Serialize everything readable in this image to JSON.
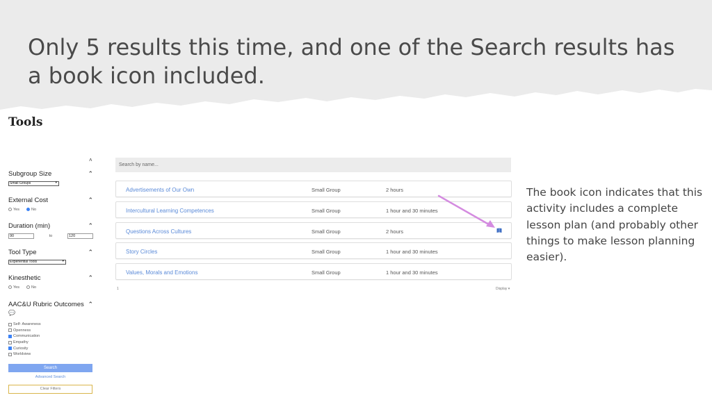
{
  "slide": {
    "title": "Only 5 results this time, and one of the Search results has a book icon included.",
    "note": "The book icon indicates that this activity includes a complete lesson plan (and probably other things to make lesson planning easier)."
  },
  "tools": {
    "heading": "Tools",
    "collapse_caret": "˄",
    "filters": {
      "subgroup_size": {
        "label": "Subgroup Size",
        "selected": "Small Groups"
      },
      "external_cost": {
        "label": "External Cost",
        "options": [
          "Yes",
          "No"
        ],
        "selected": "No"
      },
      "duration": {
        "label": "Duration (min)",
        "min": "90",
        "to": "to",
        "max": "120"
      },
      "tool_type": {
        "label": "Tool Type",
        "selected": "Experiential Tools"
      },
      "kinesthetic": {
        "label": "Kinesthetic",
        "options": [
          "Yes",
          "No"
        ],
        "selected": ""
      },
      "rubric": {
        "label": "AAC&U Rubric Outcomes",
        "items": [
          {
            "label": "Self- Awareness",
            "checked": false
          },
          {
            "label": "Openness",
            "checked": false
          },
          {
            "label": "Communication",
            "checked": true
          },
          {
            "label": "Empathy",
            "checked": false
          },
          {
            "label": "Curiosity",
            "checked": true
          },
          {
            "label": "Worldview",
            "checked": false
          }
        ]
      }
    },
    "search_label": "Search",
    "advanced_label": "Advanced Search",
    "clear_label": "Clear Filters"
  },
  "results": {
    "search_placeholder": "Search by name...",
    "rows": [
      {
        "name": "Advertisements of Our Own",
        "size": "Small Group",
        "duration": "2 hours",
        "has_lesson_plan": false
      },
      {
        "name": "Intercultural Learning Competences",
        "size": "Small Group",
        "duration": "1 hour and 30 minutes",
        "has_lesson_plan": false
      },
      {
        "name": "Questions Across Cultures",
        "size": "Small Group",
        "duration": "2 hours",
        "has_lesson_plan": true
      },
      {
        "name": "Story Circles",
        "size": "Small Group",
        "duration": "1 hour and 30 minutes",
        "has_lesson_plan": false
      },
      {
        "name": "Values, Morals and Emotions",
        "size": "Small Group",
        "duration": "1 hour and 30 minutes",
        "has_lesson_plan": false
      }
    ],
    "pager_left": "1",
    "pager_right": "Display ▾"
  },
  "colors": {
    "link": "#5a8ad8",
    "arrow": "#d48be0",
    "search_button": "#7fa6f0",
    "header_band": "#ebebeb"
  },
  "icons": {
    "book": "book-icon",
    "chevron": "chevron-up-icon",
    "chat": "speech-bubble-icon"
  }
}
